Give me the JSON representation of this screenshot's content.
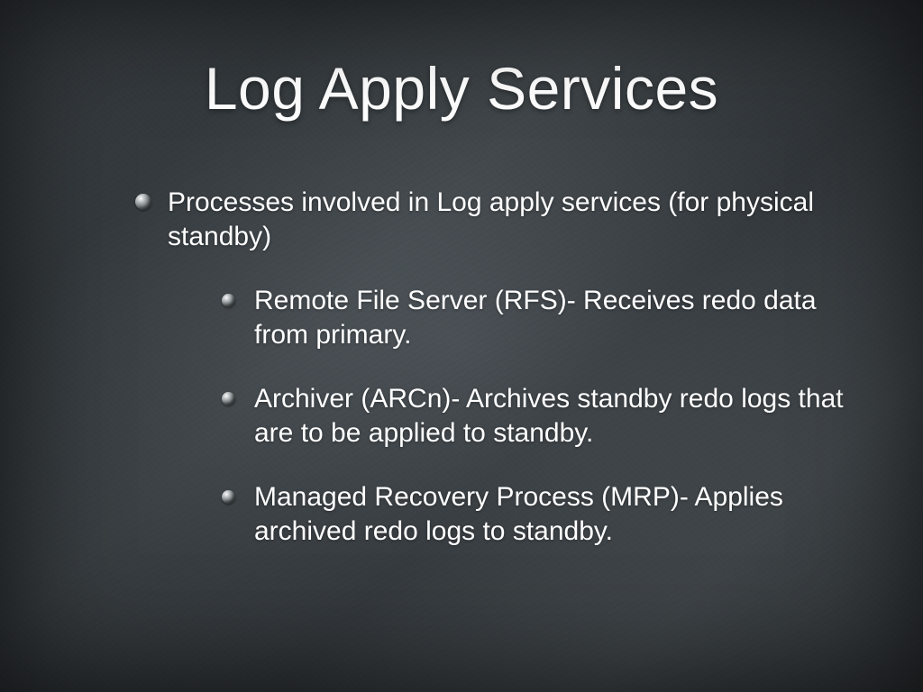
{
  "slide": {
    "title": "Log Apply Services",
    "bullets": [
      {
        "text": "Processes involved in Log apply services (for physical standby)",
        "children": [
          {
            "text": "Remote File Server (RFS)- Receives redo data from primary."
          },
          {
            "text": "Archiver (ARCn)- Archives standby redo logs that are to be applied to standby."
          },
          {
            "text": "Managed Recovery Process (MRP)- Applies archived redo logs to standby."
          }
        ]
      }
    ]
  }
}
